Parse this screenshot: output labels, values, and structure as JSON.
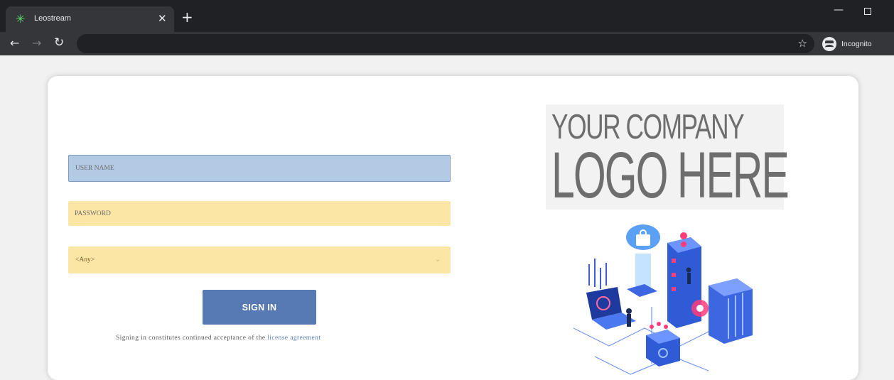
{
  "browser": {
    "tab_title": "Leostream",
    "tab_close_glyph": "✕",
    "new_tab_glyph": "+",
    "incognito_label": "Incognito"
  },
  "login": {
    "username_placeholder": "USER NAME",
    "password_placeholder": "PASSWORD",
    "domain_selected": "<Any>",
    "signin_label": "SIGN IN",
    "legal_text": "Signing in constitutes continued acceptance of the ",
    "license_link": "license agreement"
  },
  "logo": {
    "line1": "YOUR COMPANY",
    "line2": "LOGO HERE"
  },
  "colors": {
    "username_bg": "#b3cae4",
    "password_bg": "#fbe6a6",
    "signin_bg": "#5779b4",
    "link": "#5b7fb5"
  },
  "icons": [
    "leostream-favicon",
    "close-icon",
    "plus-icon",
    "minimize-icon",
    "maximize-icon",
    "back-arrow-icon",
    "forward-arrow-icon",
    "reload-icon",
    "star-icon",
    "incognito-icon",
    "chevron-down-icon",
    "datacenter-illustration"
  ]
}
